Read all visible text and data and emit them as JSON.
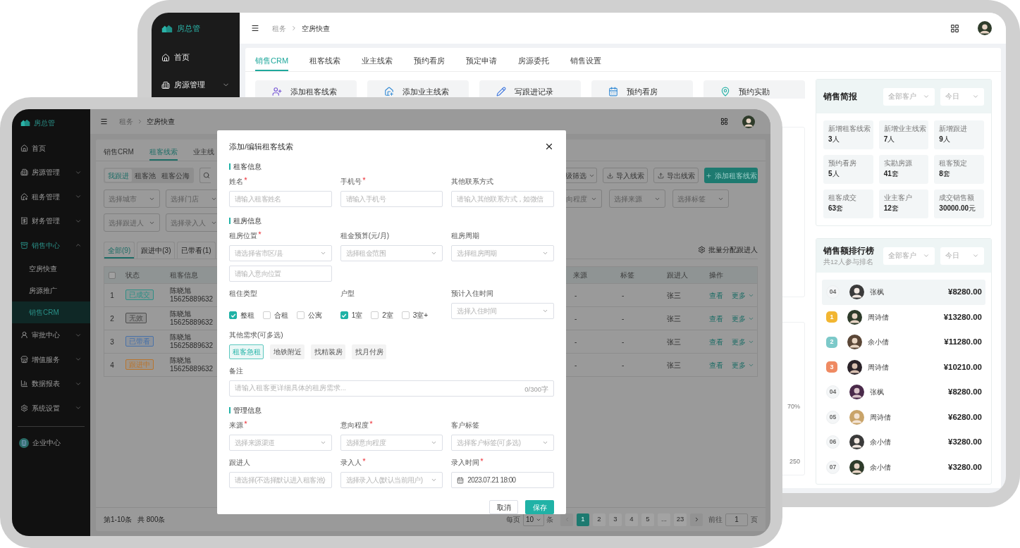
{
  "back_device": {
    "brand": "房总管",
    "sidebar": [
      {
        "label": "首页",
        "kind": "link"
      },
      {
        "label": "房源管理",
        "kind": "group",
        "expanded": false
      }
    ],
    "breadcrumb": [
      "租务",
      "空房快查"
    ],
    "tabs": [
      {
        "label": "销售CRM",
        "selected": true
      },
      {
        "label": "租客线索",
        "selected": false
      },
      {
        "label": "业主线索",
        "selected": false
      },
      {
        "label": "预约看房",
        "selected": false
      },
      {
        "label": "预定申请",
        "selected": false
      },
      {
        "label": "房源委托",
        "selected": false
      },
      {
        "label": "销售设置",
        "selected": false
      }
    ],
    "quick_actions": [
      "添加租客线索",
      "添加业主线索",
      "写跟进记录",
      "预约看房",
      "预约实勘"
    ],
    "chart_fragment": {
      "labels": [
        "70%",
        "250"
      ]
    },
    "summary": {
      "title": "销售简报",
      "filters": [
        "全部客户",
        "今日"
      ],
      "stats": [
        {
          "label": "新增租客线索",
          "value": "**3**人"
        },
        {
          "label": "新增业主线索",
          "value": "**7**人"
        },
        {
          "label": "新增跟进",
          "value": "**9**人"
        },
        {
          "label": "预约看房",
          "value": "**5**人"
        },
        {
          "label": "实勘房源",
          "value": "**41**套"
        },
        {
          "label": "租客预定",
          "value": "**8**套"
        },
        {
          "label": "租客成交",
          "value": "**63**套"
        },
        {
          "label": "业主客户",
          "value": "**12**套"
        },
        {
          "label": "成交销售额",
          "value": "**30000.00**元"
        }
      ]
    },
    "ranking": {
      "title": "销售额排行榜",
      "subtitle": "共12人参与排名",
      "filters": [
        "全部客户",
        "今日"
      ],
      "rows": [
        {
          "kind": "number",
          "rank": "04",
          "name": "张枫",
          "amount": "¥8280.00",
          "selected": true
        },
        {
          "kind": "medal",
          "rank": "1",
          "color": "#f2b632",
          "name": "周诗倩",
          "amount": "¥13280.00",
          "selected": false
        },
        {
          "kind": "medal",
          "rank": "2",
          "color": "#7cc9c9",
          "name": "余小倩",
          "amount": "¥11280.00",
          "selected": false
        },
        {
          "kind": "medal",
          "rank": "3",
          "color": "#ef8a62",
          "name": "周诗倩",
          "amount": "¥10210.00",
          "selected": false
        },
        {
          "kind": "number",
          "rank": "04",
          "name": "张枫",
          "amount": "¥8280.00",
          "selected": false
        },
        {
          "kind": "number",
          "rank": "05",
          "name": "周诗倩",
          "amount": "¥6280.00",
          "selected": false
        },
        {
          "kind": "number",
          "rank": "06",
          "name": "余小倩",
          "amount": "¥3280.00",
          "selected": false
        },
        {
          "kind": "number",
          "rank": "07",
          "name": "余小倩",
          "amount": "¥3280.00",
          "selected": false
        }
      ]
    }
  },
  "front_device": {
    "brand": "房总管",
    "sidebar": [
      {
        "label": "首页",
        "kind": "link",
        "selected": false
      },
      {
        "label": "房源管理",
        "kind": "group",
        "expanded": false,
        "selected": false
      },
      {
        "label": "租务管理",
        "kind": "group",
        "expanded": false,
        "selected": false
      },
      {
        "label": "财务管理",
        "kind": "group",
        "expanded": false,
        "selected": false
      },
      {
        "label": "销售中心",
        "kind": "group",
        "expanded": true,
        "selected": true,
        "children": [
          {
            "label": "空房快查",
            "selected": false
          },
          {
            "label": "房源推广",
            "selected": false
          },
          {
            "label": "销售CRM",
            "selected": true
          }
        ]
      },
      {
        "label": "审批中心",
        "kind": "group",
        "expanded": false,
        "selected": false
      },
      {
        "label": "增值服务",
        "kind": "group",
        "expanded": false,
        "selected": false
      },
      {
        "label": "数据报表",
        "kind": "group",
        "expanded": false,
        "selected": false
      },
      {
        "label": "系统设置",
        "kind": "group",
        "expanded": false,
        "selected": false
      },
      {
        "label": "企业中心",
        "kind": "footer",
        "selected": false
      }
    ],
    "breadcrumb": [
      "租务",
      "空房快查"
    ],
    "tabs": [
      {
        "label": "销售CRM",
        "selected": false
      },
      {
        "label": "租客线索",
        "selected": true
      },
      {
        "label": "业主线",
        "selected": false
      }
    ],
    "segments": [
      {
        "label": "我跟进",
        "selected": true
      },
      {
        "label": "租客池",
        "selected": false
      },
      {
        "label": "租客公海",
        "selected": false
      }
    ],
    "filter_button": "级筛选",
    "buttons": [
      {
        "label": "导入线索",
        "kind": "import"
      },
      {
        "label": "导出线索",
        "kind": "export"
      },
      {
        "label": "添加租客线索",
        "kind": "primary"
      }
    ],
    "filters_left": [
      [
        "选择城市",
        "选择门店"
      ],
      [
        "选择跟进人",
        "选择录入人"
      ]
    ],
    "filters_right": [
      "向程度",
      "选择来源",
      "选择标签"
    ],
    "status_tabs": [
      {
        "label": "全部(9)",
        "selected": true
      },
      {
        "label": "跟进中(3)",
        "selected": false
      },
      {
        "label": "已带看(1)",
        "selected": false
      }
    ],
    "batch_action": "批量分配跟进人",
    "table": {
      "select_all": {
        "checked": false
      },
      "columns_left": [
        "状态",
        "租客信息"
      ],
      "columns_right": [
        "来源",
        "标签",
        "跟进人",
        "操作"
      ],
      "rows": [
        {
          "index": "1",
          "status": "已成交",
          "color": "#2f8f86",
          "name": "陈晓旭",
          "phone": "15625889632",
          "source": "-",
          "tag": "-",
          "follower": "张三",
          "actions": [
            "查看",
            "更多"
          ]
        },
        {
          "index": "2",
          "status": "无效",
          "color": "#4e4e4e",
          "name": "陈晓旭",
          "phone": "15625889632",
          "source": "-",
          "tag": "-",
          "follower": "张三",
          "actions": [
            "查看",
            "更多"
          ]
        },
        {
          "index": "3",
          "status": "已带看",
          "color": "#4a72a8",
          "name": "陈晓旭",
          "phone": "15625889632",
          "source": "-",
          "tag": "-",
          "follower": "张三",
          "actions": [
            "查看",
            "更多"
          ]
        },
        {
          "index": "4",
          "status": "跟进中",
          "color": "#b8752f",
          "name": "陈晓旭",
          "phone": "15625889632",
          "source": "-",
          "tag": "-",
          "follower": "张三",
          "actions": [
            "查看",
            "更多"
          ]
        }
      ]
    },
    "pagination": {
      "range": "第1-10条",
      "total": "共 800条",
      "per_page_label": "每页",
      "per_page": "10",
      "per_page_unit": "条",
      "pages": [
        {
          "label": "1",
          "selected": true
        },
        {
          "label": "2",
          "selected": false
        },
        {
          "label": "3",
          "selected": false
        },
        {
          "label": "4",
          "selected": false
        },
        {
          "label": "5",
          "selected": false
        },
        {
          "label": "...",
          "selected": false
        },
        {
          "label": "23",
          "selected": false
        }
      ],
      "goto_label": "前往",
      "goto_value": "1",
      "goto_unit": "页"
    }
  },
  "modal": {
    "title": "添加/编辑租客线索",
    "sections": [
      {
        "title": "租客信息",
        "fields": [
          {
            "label": "姓名",
            "required": true,
            "kind": "input",
            "placeholder": "请输入租客姓名"
          },
          {
            "label": "手机号",
            "required": true,
            "kind": "input",
            "placeholder": "请输入手机号"
          },
          {
            "label": "其他联系方式",
            "required": false,
            "kind": "input",
            "placeholder": "请输入其他联系方式，如微信"
          }
        ]
      },
      {
        "title": "租房信息",
        "fields": [
          {
            "label": "租房位置",
            "required": true,
            "kind": "select",
            "placeholder": "请选择省市区/县",
            "extra_placeholder": "请输入意向位置"
          },
          {
            "label": "租金预算(元/月)",
            "required": false,
            "kind": "select",
            "placeholder": "选择租金范围"
          },
          {
            "label": "租房周期",
            "required": false,
            "kind": "select",
            "placeholder": "选择租房周期"
          },
          {
            "label": "租住类型",
            "required": false,
            "kind": "checks",
            "options": [
              {
                "label": "整租",
                "checked": true
              },
              {
                "label": "合租",
                "checked": false
              },
              {
                "label": "公寓",
                "checked": false
              }
            ]
          },
          {
            "label": "户型",
            "required": false,
            "kind": "checks",
            "options": [
              {
                "label": "1室",
                "checked": true
              },
              {
                "label": "2室",
                "checked": false
              },
              {
                "label": "3室+",
                "checked": false
              }
            ]
          },
          {
            "label": "预计入住时间",
            "required": false,
            "kind": "select",
            "placeholder": "选择入住时间"
          },
          {
            "label": "其他需求(可多选)",
            "required": false,
            "kind": "chips",
            "options": [
              {
                "label": "租客急租",
                "selected": true
              },
              {
                "label": "地铁附近",
                "selected": false
              },
              {
                "label": "找精装房",
                "selected": false
              },
              {
                "label": "找月付房",
                "selected": false
              }
            ]
          },
          {
            "label": "备注",
            "required": false,
            "kind": "textarea",
            "placeholder": "请输入租客更详细具体的租房需求...",
            "counter": "0/300字"
          }
        ]
      },
      {
        "title": "管理信息",
        "fields": [
          {
            "label": "来源",
            "required": true,
            "kind": "select",
            "placeholder": "选择来源渠道"
          },
          {
            "label": "意向程度",
            "required": true,
            "kind": "select",
            "placeholder": "选择意向程度"
          },
          {
            "label": "客户标签",
            "required": false,
            "kind": "select",
            "placeholder": "选择客户标签(可多选)"
          },
          {
            "label": "跟进人",
            "required": false,
            "kind": "select",
            "placeholder": "请选择(不选择默认进入租客池)"
          },
          {
            "label": "录入人",
            "required": true,
            "kind": "select",
            "placeholder": "选择录入人(默认当前用户)"
          },
          {
            "label": "录入时间",
            "required": true,
            "kind": "date",
            "value": "2023.07.21 18:00"
          }
        ]
      }
    ],
    "buttons": [
      {
        "label": "取消",
        "kind": "secondary"
      },
      {
        "label": "保存",
        "kind": "primary"
      }
    ]
  }
}
